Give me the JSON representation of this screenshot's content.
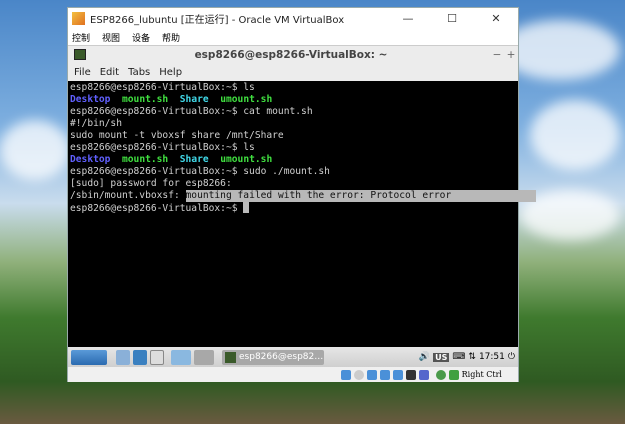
{
  "window": {
    "title": "ESP8266_lubuntu [正在运行] - Oracle VM VirtualBox",
    "minimize": "—",
    "maximize": "☐",
    "close": "✕",
    "menu": [
      "控制",
      "视图",
      "设备",
      "帮助"
    ]
  },
  "terminal": {
    "title": "esp8266@esp8266-VirtualBox: ~",
    "min": "−",
    "add": "+",
    "menu": [
      "File",
      "Edit",
      "Tabs",
      "Help"
    ],
    "prompt": "esp8266@esp8266-VirtualBox:~$ ",
    "lines": {
      "c1": "ls",
      "ls1": [
        "Desktop",
        "mount.sh",
        "Share",
        "umount.sh"
      ],
      "c2": "cat mount.sh",
      "o1": "#!/bin/sh",
      "o2": "sudo mount -t vboxsf share /mnt/Share",
      "c3": "ls",
      "c4": "sudo ./mount.sh",
      "o3": "[sudo] password for esp8266:",
      "err_prefix": "/sbin/mount.vboxsf: ",
      "err": "mounting failed with the error: Protocol error"
    }
  },
  "taskbar": {
    "task": "esp8266@esp82…",
    "layout": "US",
    "time": "17:51"
  },
  "statusbar": {
    "host_key": "Right Ctrl"
  }
}
